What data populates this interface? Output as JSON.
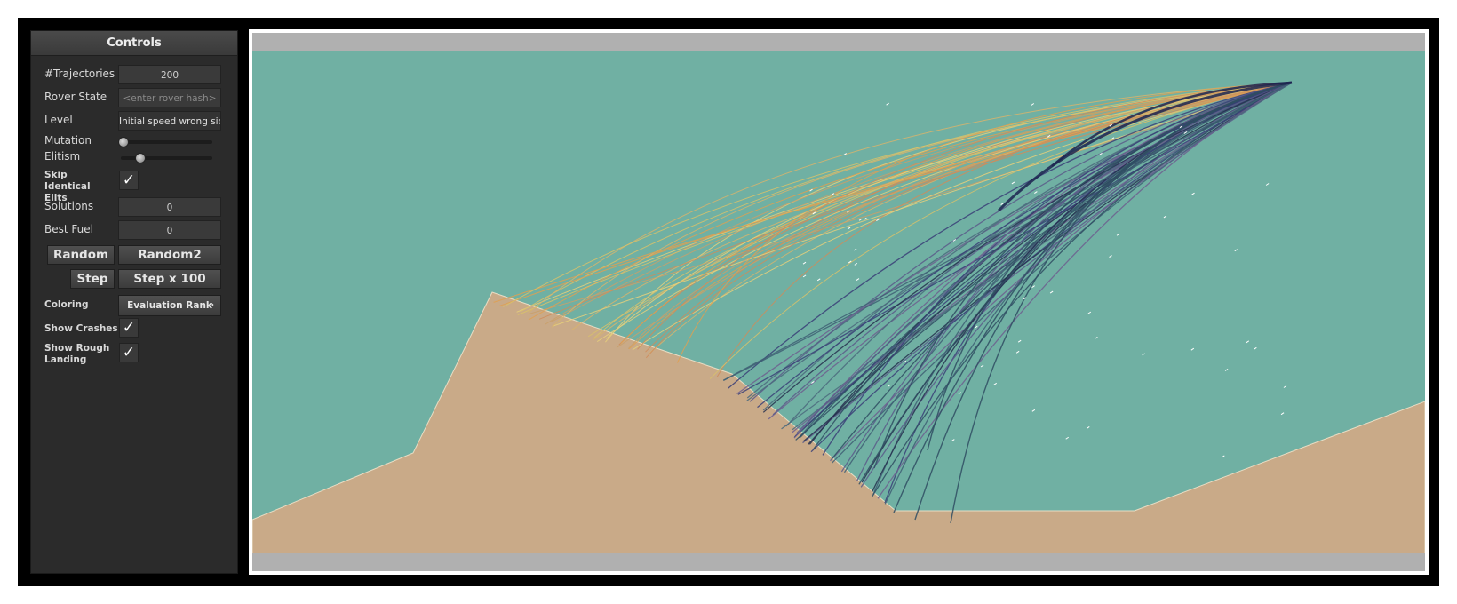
{
  "panel": {
    "title": "Controls",
    "trajectories_label": "#Trajectories",
    "trajectories_value": "200",
    "rover_state_label": "Rover State",
    "rover_state_placeholder": "<enter rover hash>",
    "level_label": "Level",
    "level_value": "Initial speed wrong side",
    "mutation_label": "Mutation",
    "mutation_value": 0.02,
    "elitism_label": "Elitism",
    "elitism_value": 0.2,
    "skip_identical_label": "Skip Identical Elits",
    "skip_identical_checked": true,
    "solutions_label": "Solutions",
    "solutions_value": "0",
    "best_fuel_label": "Best Fuel",
    "best_fuel_value": "0",
    "random_label": "Random",
    "random2_label": "Random2",
    "step_label": "Step",
    "step100_label": "Step x 100",
    "coloring_label": "Coloring",
    "coloring_value": "Evaluation Rank",
    "coloring_icon": "chevron-right-icon",
    "show_crashes_label": "Show Crashes",
    "show_crashes_checked": true,
    "show_rough_label": "Show Rough Landing",
    "show_rough_checked": true,
    "check_glyph": "✓"
  },
  "colors": {
    "sky": "#70b0a3",
    "ground": "#c9aa88",
    "bar": "#b0b0b0",
    "panel": "#2b2b2b"
  }
}
